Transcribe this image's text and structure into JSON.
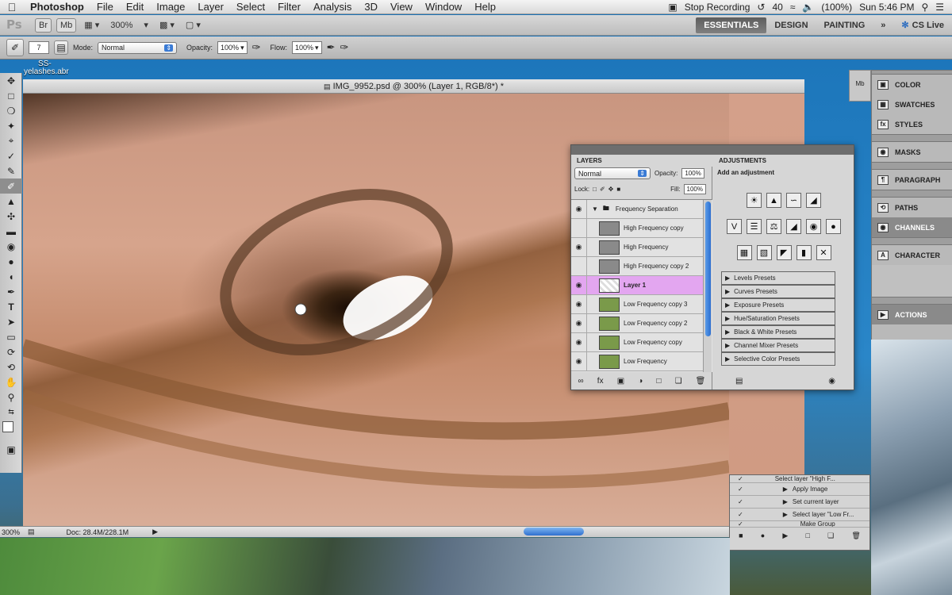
{
  "menubar": {
    "apple": "",
    "items": [
      "Photoshop",
      "File",
      "Edit",
      "Image",
      "Layer",
      "Select",
      "Filter",
      "Analysis",
      "3D",
      "View",
      "Window",
      "Help"
    ],
    "stop_recording": "Stop Recording",
    "battery_num": "40",
    "battery": "(100%)",
    "clock": "Sun 5:46 PM"
  },
  "appbar": {
    "logo": "Ps",
    "btn1": "Br",
    "btn2": "Mb",
    "zoom": "300%",
    "workspaces": [
      "ESSENTIALS",
      "DESIGN",
      "PAINTING"
    ],
    "more": "»",
    "cslive": "CS Live"
  },
  "options": {
    "brush_size": "7",
    "mode_label": "Mode:",
    "mode_value": "Normal",
    "opacity_label": "Opacity:",
    "opacity_value": "100%",
    "flow_label": "Flow:",
    "flow_value": "100%"
  },
  "desktop": {
    "file_line1": "SS-",
    "file_line2": "yelashes.abr"
  },
  "document": {
    "title": "IMG_9952.psd @ 300% (Layer 1, RGB/8*) *",
    "status_zoom": "300%",
    "status_doc": "Doc: 28.4M/228.1M"
  },
  "dock": {
    "items": [
      "COLOR",
      "SWATCHES",
      "STYLES",
      "MASKS",
      "PARAGRAPH",
      "PATHS",
      "CHANNELS",
      "CHARACTER",
      "ACTIONS"
    ]
  },
  "layers": {
    "tab": "LAYERS",
    "blend": "Normal",
    "opacity_label": "Opacity:",
    "opacity": "100%",
    "lock_label": "Lock:",
    "fill_label": "Fill:",
    "fill": "100%",
    "group": "Frequency Separation",
    "rows": [
      "High Frequency copy",
      "High Frequency",
      "High Frequency copy 2",
      "Layer 1",
      "Low Frequency copy 3",
      "Low Frequency copy 2",
      "Low Frequency copy",
      "Low Frequency"
    ]
  },
  "adjustments": {
    "tab": "ADJUSTMENTS",
    "heading": "Add an adjustment",
    "presets": [
      "Levels Presets",
      "Curves Presets",
      "Exposure Presets",
      "Hue/Saturation Presets",
      "Black & White Presets",
      "Channel Mixer Presets",
      "Selective Color Presets"
    ]
  },
  "actions": {
    "rows": [
      "Select layer \"High F...",
      "Apply Image",
      "Set current layer",
      "Select layer \"Low Fr...",
      "Make Group"
    ]
  }
}
